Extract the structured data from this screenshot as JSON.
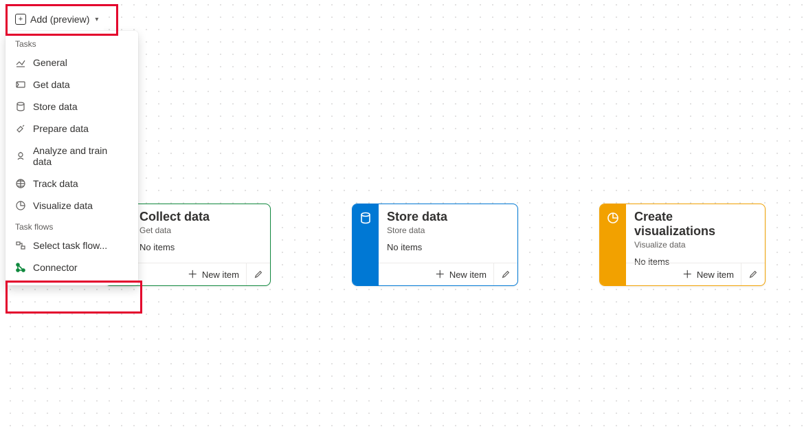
{
  "toolbar": {
    "add_label": "Add (preview)"
  },
  "menu": {
    "tasks_header": "Tasks",
    "taskflows_header": "Task flows",
    "items": {
      "general": "General",
      "get_data": "Get data",
      "store_data": "Store data",
      "prepare_data": "Prepare data",
      "analyze": "Analyze and train data",
      "track_data": "Track data",
      "visualize": "Visualize data",
      "select_flow": "Select task flow...",
      "connector": "Connector"
    }
  },
  "cards": {
    "collect": {
      "title": "Collect data",
      "subtitle": "Get data",
      "status": "No items",
      "new_label": "New item",
      "accent_color": "#10893e"
    },
    "store": {
      "title": "Store data",
      "subtitle": "Store data",
      "status": "No items",
      "new_label": "New item",
      "accent_color": "#0078d4"
    },
    "viz": {
      "title": "Create visualizations",
      "subtitle": "Visualize data",
      "status": "No items",
      "new_label": "New item",
      "accent_color": "#f2a100"
    }
  }
}
